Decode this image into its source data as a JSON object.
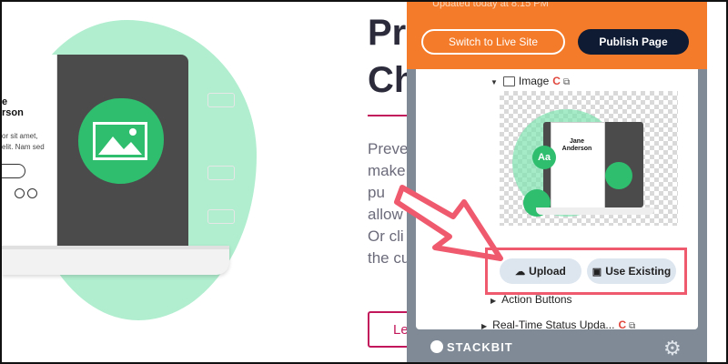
{
  "hero": {
    "heading_line1": "Pr",
    "heading_line2": "Ch",
    "body_lines": [
      "Preve",
      "make",
      "pu",
      "allow",
      "Or cli",
      "the cu"
    ],
    "learn_button": "Le"
  },
  "illustration": {
    "profile_name": "e\nrson",
    "profile_text": "or sit amet,\nelit. Nam sed"
  },
  "panel": {
    "updated_text": "Updated today at 8:15 PM",
    "live_button": "Switch to Live Site",
    "publish_button": "Publish Page",
    "tree": {
      "image_label": "Image",
      "action_buttons_label": "Action Buttons",
      "status_label": "Real-Time Status Upda..."
    },
    "thumbnail": {
      "aa_label": "Aa",
      "person_name": "Jane Anderson"
    },
    "upload_button": "Upload",
    "use_existing_button": "Use Existing",
    "brand": "STACKBIT"
  },
  "colors": {
    "accent": "#c2185b",
    "panel_orange": "#f47b2a",
    "publish_navy": "#0f1b33",
    "highlight_red": "#f05a6e",
    "green": "#2fbd6e"
  },
  "icons": [
    "image-icon",
    "external-link-icon",
    "cloud-upload-icon",
    "gallery-icon",
    "gear-icon",
    "stackbit-logo-icon"
  ]
}
